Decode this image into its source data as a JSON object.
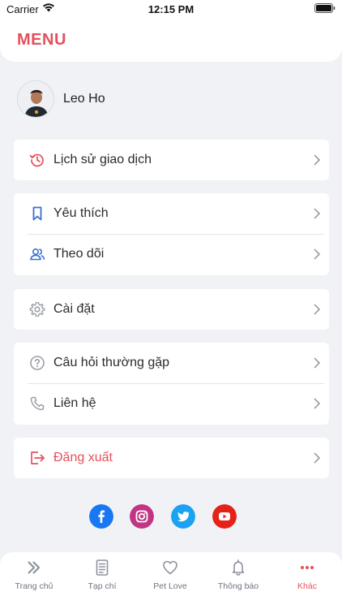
{
  "status_bar": {
    "carrier": "Carrier",
    "time": "12:15 PM"
  },
  "header": {
    "title": "MENU"
  },
  "profile": {
    "name": "Leo Ho"
  },
  "menu": {
    "history": "Lịch sử giao dịch",
    "favorites": "Yêu thích",
    "following": "Theo dõi",
    "settings": "Cài đặt",
    "faq": "Câu hỏi thường gặp",
    "contact": "Liên hệ",
    "logout": "Đăng xuất"
  },
  "social": {
    "facebook_color": "#1877f2",
    "instagram_color": "#c13584",
    "twitter_color": "#1da1f2",
    "youtube_color": "#e62117"
  },
  "tabbar": {
    "home": "Trang chủ",
    "magazine": "Tạp chí",
    "pet_love": "Pet Love",
    "notifications": "Thông báo",
    "more": "Khác"
  },
  "colors": {
    "accent": "#e5505a",
    "icon_blue": "#3b6fd6",
    "icon_gray": "#9a9ea8"
  }
}
